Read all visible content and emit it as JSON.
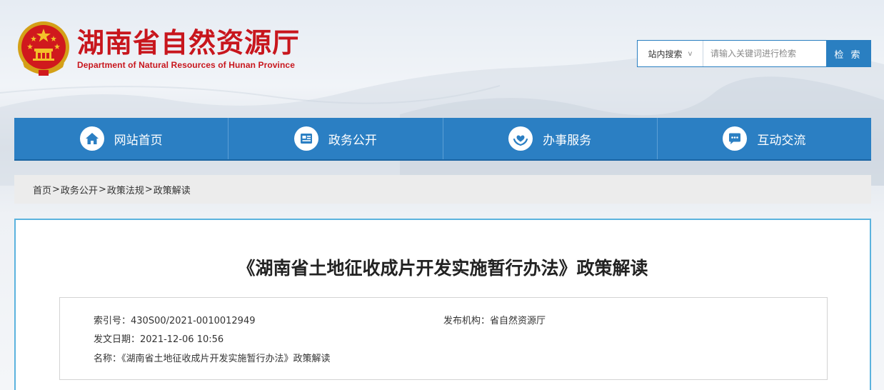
{
  "header": {
    "title_cn": "湖南省自然资源厅",
    "title_en": "Department of Natural Resources of Hunan Province"
  },
  "search": {
    "scope_label": "站内搜索",
    "scope_caret": "v",
    "placeholder": "请输入关键词进行检索",
    "button_label": "检 索"
  },
  "nav": {
    "items": [
      {
        "label": "网站首页",
        "icon": "home-icon"
      },
      {
        "label": "政务公开",
        "icon": "document-icon"
      },
      {
        "label": "办事服务",
        "icon": "service-heart-icon"
      },
      {
        "label": "互动交流",
        "icon": "chat-icon"
      }
    ]
  },
  "breadcrumb": {
    "items": [
      "首页",
      "政务公开",
      "政策法规",
      "政策解读"
    ],
    "separator": ">"
  },
  "article": {
    "title": "《湖南省土地征收成片开发实施暂行办法》政策解读",
    "meta": {
      "index_label": "索引号：",
      "index_value": "430S00/2021-0010012949",
      "publisher_label": "发布机构：",
      "publisher_value": "省自然资源厅",
      "date_label": "发文日期：",
      "date_value": "2021-12-06 10:56",
      "name_label": "名称：",
      "name_value": "《湖南省土地征收成片开发实施暂行办法》政策解读"
    }
  },
  "colors": {
    "brand_red": "#c8161d",
    "nav_blue": "#2b7fc3",
    "content_border": "#5bb3de"
  }
}
